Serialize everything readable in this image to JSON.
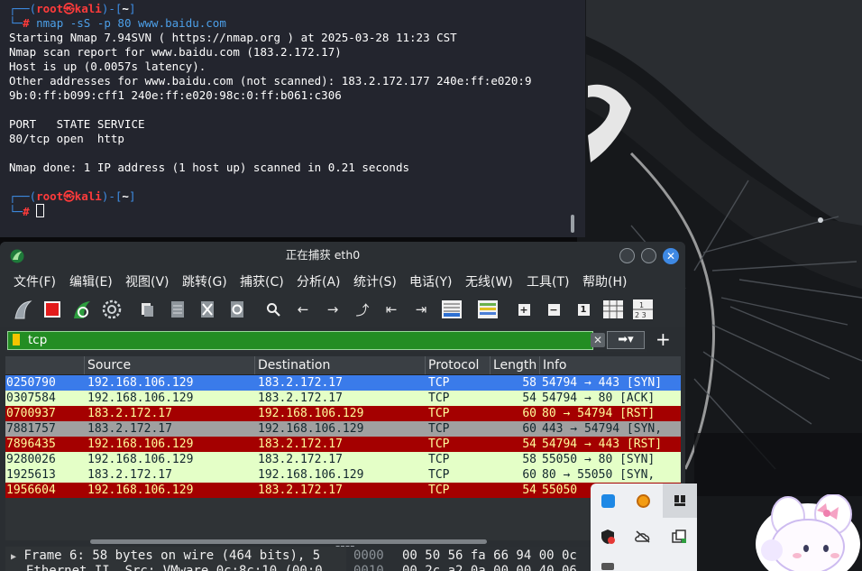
{
  "terminal": {
    "prompt_user": "root",
    "prompt_at": "㉿",
    "prompt_host": "kali",
    "prompt_dir": "~",
    "prompt_hash": "#",
    "command": "nmap -sS -p 80 www.baidu.com",
    "output": [
      "Starting Nmap 7.94SVN ( https://nmap.org ) at 2025-03-28 11:23 CST",
      "Nmap scan report for www.baidu.com (183.2.172.17)",
      "Host is up (0.0057s latency).",
      "Other addresses for www.baidu.com (not scanned): 183.2.172.177 240e:ff:e020:9",
      "9b:0:ff:b099:cff1 240e:ff:e020:98c:0:ff:b061:c306",
      "",
      "PORT   STATE SERVICE",
      "80/tcp open  http",
      "",
      "Nmap done: 1 IP address (1 host up) scanned in 0.21 seconds"
    ]
  },
  "wireshark": {
    "title": "正在捕获 eth0",
    "menu": [
      "文件(F)",
      "编辑(E)",
      "视图(V)",
      "跳转(G)",
      "捕获(C)",
      "分析(A)",
      "统计(S)",
      "电话(Y)",
      "无线(W)",
      "工具(T)",
      "帮助(H)"
    ],
    "filter": "tcp",
    "columns": [
      "Source",
      "Destination",
      "Protocol",
      "Length",
      "Info"
    ],
    "packets": [
      {
        "time": "0250790",
        "src": "192.168.106.129",
        "dst": "183.2.172.17",
        "proto": "TCP",
        "len": "58",
        "info": "54794 → 443 [SYN]",
        "bg": "#3a7bea",
        "fg": "#ffffff"
      },
      {
        "time": "0307584",
        "src": "192.168.106.129",
        "dst": "183.2.172.17",
        "proto": "TCP",
        "len": "54",
        "info": "54794 → 80 [ACK]",
        "bg": "#e4ffc7",
        "fg": "#12272e"
      },
      {
        "time": "0700937",
        "src": "183.2.172.17",
        "dst": "192.168.106.129",
        "proto": "TCP",
        "len": "60",
        "info": "80 → 54794 [RST]",
        "bg": "#a40000",
        "fg": "#fffc9c"
      },
      {
        "time": "7881757",
        "src": "183.2.172.17",
        "dst": "192.168.106.129",
        "proto": "TCP",
        "len": "60",
        "info": "443 → 54794 [SYN,",
        "bg": "#a0a0a0",
        "fg": "#12272e"
      },
      {
        "time": "7896435",
        "src": "192.168.106.129",
        "dst": "183.2.172.17",
        "proto": "TCP",
        "len": "54",
        "info": "54794 → 443 [RST]",
        "bg": "#a40000",
        "fg": "#fffc9c"
      },
      {
        "time": "9280026",
        "src": "192.168.106.129",
        "dst": "183.2.172.17",
        "proto": "TCP",
        "len": "58",
        "info": "55050 → 80 [SYN]",
        "bg": "#e4ffc7",
        "fg": "#12272e"
      },
      {
        "time": "1925613",
        "src": "183.2.172.17",
        "dst": "192.168.106.129",
        "proto": "TCP",
        "len": "60",
        "info": "80 → 55050 [SYN,",
        "bg": "#e4ffc7",
        "fg": "#12272e"
      },
      {
        "time": "1956604",
        "src": "192.168.106.129",
        "dst": "183.2.172.17",
        "proto": "TCP",
        "len": "54",
        "info": "55050",
        "bg": "#a40000",
        "fg": "#fffc9c"
      }
    ],
    "detail": {
      "frame_line": "Frame 6: 58 bytes on wire (464 bits), 5",
      "ethernet_line": "Ethernet II, Src: VMware_0c:8c:10 (00:0",
      "hex_offset_1": "0000",
      "hex_bytes_1": "00 50 56 fa 66 94 00 0c",
      "hex_offset_2": "0010",
      "hex_bytes_2": "00 2c a2 0a 00 00 40 06"
    }
  }
}
